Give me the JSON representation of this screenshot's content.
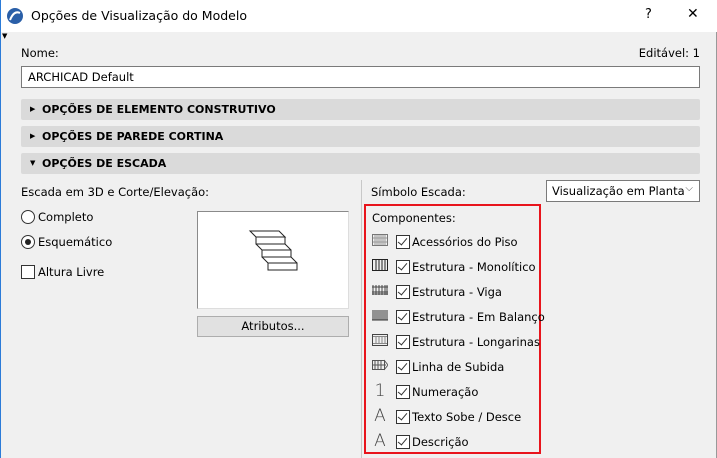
{
  "window": {
    "title": "Opções de Visualização do Modelo",
    "help": "?",
    "close": "✕"
  },
  "name": {
    "label": "Nome:",
    "editable": "Editável: 1",
    "value": "ARCHICAD Default"
  },
  "sections": [
    {
      "label": "OPÇÕES DE ELEMENTO CONSTRUTIVO",
      "expanded": false
    },
    {
      "label": "OPÇÕES DE PAREDE CORTINA",
      "expanded": false
    },
    {
      "label": "OPÇÕES DE ESCADA",
      "expanded": true
    }
  ],
  "stair": {
    "mode_label": "Escada em 3D e Corte/Elevação:",
    "options": [
      {
        "label": "Completo",
        "selected": false
      },
      {
        "label": "Esquemático",
        "selected": true
      }
    ],
    "headroom": {
      "label": "Altura Livre",
      "checked": false
    },
    "attributes_button": "Atributos...",
    "symbol_label": "Símbolo Escada:",
    "symbol_value": "Visualização em Planta"
  },
  "components": {
    "label": "Componentes:",
    "items": [
      {
        "label": "Acessórios do Piso",
        "icon": "finish-icon",
        "checked": true
      },
      {
        "label": "Estrutura - Monolítico",
        "icon": "monolithic-icon",
        "checked": true
      },
      {
        "label": "Estrutura - Viga",
        "icon": "beam-icon",
        "checked": true
      },
      {
        "label": "Estrutura - Em Balanço",
        "icon": "cantilever-icon",
        "checked": true
      },
      {
        "label": "Estrutura - Longarinas",
        "icon": "stringer-icon",
        "checked": true
      },
      {
        "label": "Linha de Subida",
        "icon": "walking-line-icon",
        "checked": true
      },
      {
        "label": "Numeração",
        "icon": "numbering-icon",
        "glyph": "1",
        "checked": true
      },
      {
        "label": "Texto Sobe / Desce",
        "icon": "text-icon",
        "glyph": "A",
        "checked": true
      },
      {
        "label": "Descrição",
        "icon": "text-icon",
        "glyph": "A",
        "checked": true
      }
    ]
  },
  "colors": {
    "highlight": "#e8141c",
    "accent": "#2b7bd8"
  }
}
